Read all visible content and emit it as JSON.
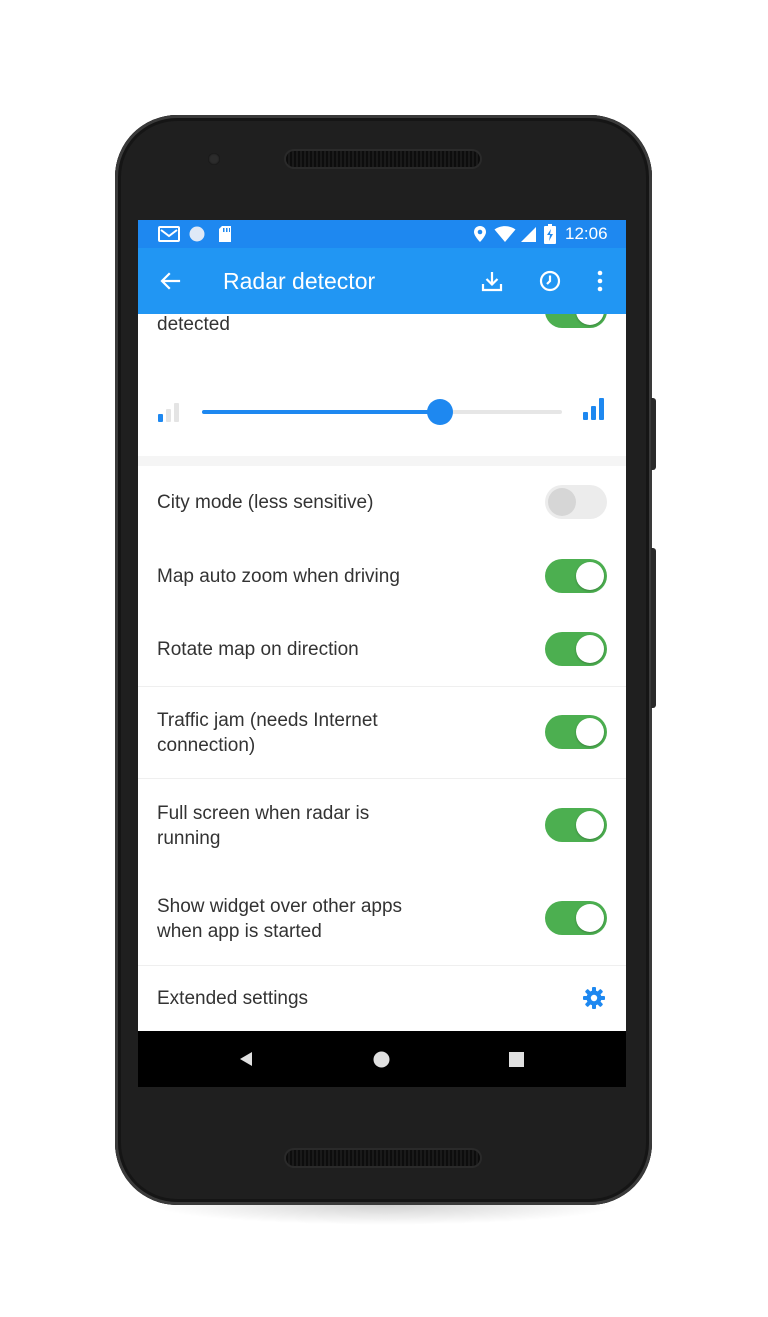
{
  "status_bar": {
    "time": "12:06",
    "left_icons": [
      "gmail-icon",
      "circle-icon",
      "sd-card-icon"
    ],
    "right_icons": [
      "location-icon",
      "wifi-icon",
      "signal-icon",
      "battery-charging-icon"
    ]
  },
  "app_bar": {
    "title": "Radar detector",
    "actions": [
      "download-icon",
      "history-icon",
      "more-vert-icon"
    ]
  },
  "partial_item": {
    "label": "detected",
    "enabled": true
  },
  "sensitivity_slider": {
    "value": 0.66,
    "min_icon": "signal-low-icon",
    "max_icon": "signal-high-icon"
  },
  "settings": [
    {
      "label_line1": "City mode (less sensitive)",
      "label_line2": "",
      "enabled": false
    },
    {
      "label_line1": "Map auto zoom when driving",
      "label_line2": "",
      "enabled": true
    },
    {
      "label_line1": "Rotate map on direction",
      "label_line2": "",
      "enabled": true
    },
    {
      "label_line1": "Traffic jam (needs Internet",
      "label_line2": "connection)",
      "enabled": true
    },
    {
      "label_line1": "Full screen when radar is",
      "label_line2": "running",
      "enabled": true
    },
    {
      "label_line1": "Show widget over other apps",
      "label_line2": "when app is started",
      "enabled": true
    }
  ],
  "extended_settings": {
    "label": "Extended settings",
    "icon": "gear-icon"
  },
  "nav_bar": {
    "buttons": [
      "back-icon",
      "home-icon",
      "recents-icon"
    ]
  },
  "colors": {
    "primary": "#2196f3",
    "status_bar": "#1e88f0",
    "switch_on": "#4caf50",
    "accent": "#1e88f0"
  }
}
